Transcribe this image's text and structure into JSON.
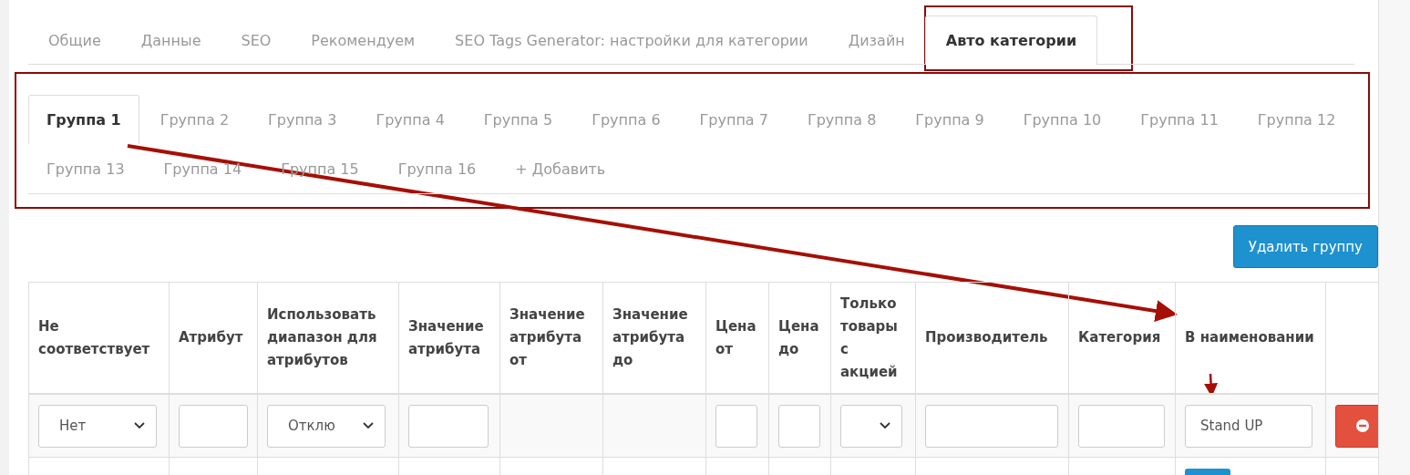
{
  "tabs": [
    {
      "label": "Общие",
      "selected": false
    },
    {
      "label": "Данные",
      "selected": false
    },
    {
      "label": "SEO",
      "selected": false
    },
    {
      "label": "Рекомендуем",
      "selected": false
    },
    {
      "label": "SEO Tags Generator: настройки для категории",
      "selected": false
    },
    {
      "label": "Дизайн",
      "selected": false
    },
    {
      "label": "Авто категории",
      "selected": true
    }
  ],
  "group_tabs": [
    {
      "label": "Группа 1",
      "selected": true
    },
    {
      "label": "Группа 2",
      "selected": false
    },
    {
      "label": "Группа 3",
      "selected": false
    },
    {
      "label": "Группа 4",
      "selected": false
    },
    {
      "label": "Группа 5",
      "selected": false
    },
    {
      "label": "Группа 6",
      "selected": false
    },
    {
      "label": "Группа 7",
      "selected": false
    },
    {
      "label": "Группа 8",
      "selected": false
    },
    {
      "label": "Группа 9",
      "selected": false
    },
    {
      "label": "Группа 10",
      "selected": false
    },
    {
      "label": "Группа 11",
      "selected": false
    },
    {
      "label": "Группа 12",
      "selected": false
    },
    {
      "label": "Группа 13",
      "selected": false
    },
    {
      "label": "Группа 14",
      "selected": false
    },
    {
      "label": "Группа 15",
      "selected": false
    },
    {
      "label": "Группа 16",
      "selected": false
    }
  ],
  "add_group_tab": "+ Добавить",
  "delete_group_button": "Удалить группу",
  "table": {
    "columns": [
      "Не соответствует",
      "Атрибут",
      "Использовать диапазон для атрибутов",
      "Значение атрибута",
      "Значение атрибута от",
      "Значение атрибута до",
      "Цена от",
      "Цена до",
      "Только товары с акцией",
      "Производитель",
      "Категория",
      "В наименовании"
    ],
    "rows": [
      {
        "cells": [
          {
            "kind": "select",
            "value": "Нет"
          },
          {
            "kind": "input"
          },
          {
            "kind": "select",
            "value": "Отклю"
          },
          {
            "kind": "input"
          },
          {
            "kind": "empty"
          },
          {
            "kind": "empty"
          },
          {
            "kind": "input"
          },
          {
            "kind": "input"
          },
          {
            "kind": "select"
          },
          {
            "kind": "input"
          },
          {
            "kind": "input"
          },
          {
            "kind": "input",
            "value": "Stand UP"
          },
          {
            "kind": "remove"
          }
        ]
      }
    ]
  }
}
